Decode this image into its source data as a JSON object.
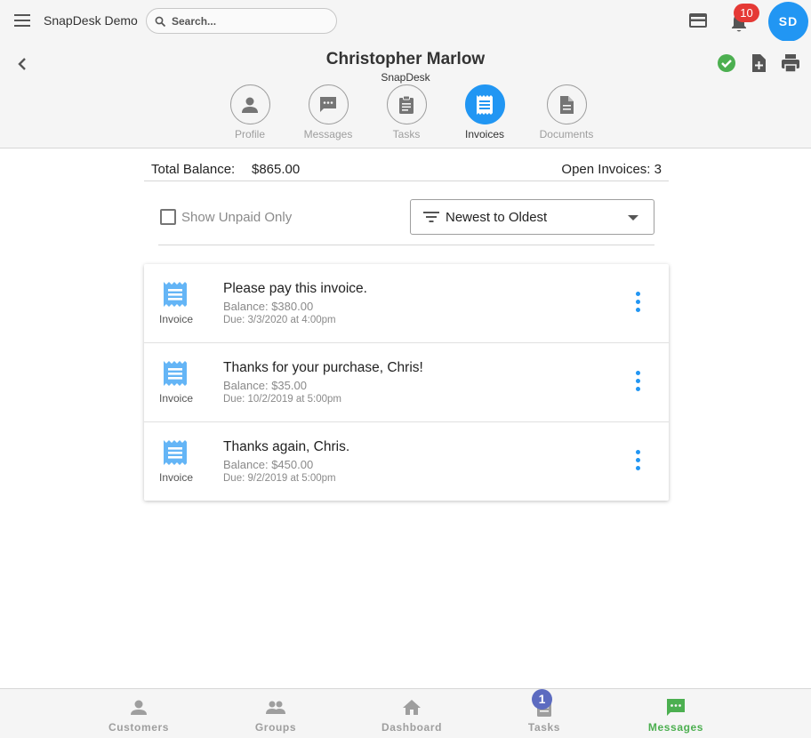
{
  "topbar": {
    "app_title": "SnapDesk Demo",
    "search_placeholder": "Search...",
    "notification_count": "10",
    "avatar_initials": "SD",
    "avatar_color": "#2196f3"
  },
  "customer": {
    "name": "Christopher Marlow",
    "company": "SnapDesk"
  },
  "tabs": [
    {
      "label": "Profile",
      "icon": "person-icon",
      "active": false
    },
    {
      "label": "Messages",
      "icon": "message-icon",
      "active": false
    },
    {
      "label": "Tasks",
      "icon": "clipboard-icon",
      "active": false
    },
    {
      "label": "Invoices",
      "icon": "receipt-icon",
      "active": true
    },
    {
      "label": "Documents",
      "icon": "document-icon",
      "active": false
    }
  ],
  "summary": {
    "total_balance_label": "Total Balance:",
    "total_balance_value": "$865.00",
    "open_invoices": "Open Invoices: 3"
  },
  "filter": {
    "show_unpaid_label": "Show Unpaid Only",
    "show_unpaid_checked": false,
    "sort_value": "Newest to Oldest"
  },
  "invoices": [
    {
      "type": "Invoice",
      "title": "Please pay this invoice.",
      "balance": "Balance: $380.00",
      "due": "Due: 3/3/2020 at 4:00pm"
    },
    {
      "type": "Invoice",
      "title": "Thanks for your purchase, Chris!",
      "balance": "Balance: $35.00",
      "due": "Due: 10/2/2019 at 5:00pm"
    },
    {
      "type": "Invoice",
      "title": "Thanks again, Chris.",
      "balance": "Balance: $450.00",
      "due": "Due: 9/2/2019 at 5:00pm"
    }
  ],
  "bottom_nav": [
    {
      "label": "Customers",
      "icon": "person-icon",
      "active": false
    },
    {
      "label": "Groups",
      "icon": "group-icon",
      "active": false
    },
    {
      "label": "Dashboard",
      "icon": "home-icon",
      "active": false
    },
    {
      "label": "Tasks",
      "icon": "clipboard-icon",
      "active": false,
      "badge": "1"
    },
    {
      "label": "Messages",
      "icon": "message-icon",
      "active": true
    }
  ],
  "colors": {
    "accent_blue": "#2196f3",
    "active_green": "#4caf50",
    "badge_red": "#e53935",
    "tasks_badge": "#5c6bc0",
    "status_check": "#4caf50"
  }
}
